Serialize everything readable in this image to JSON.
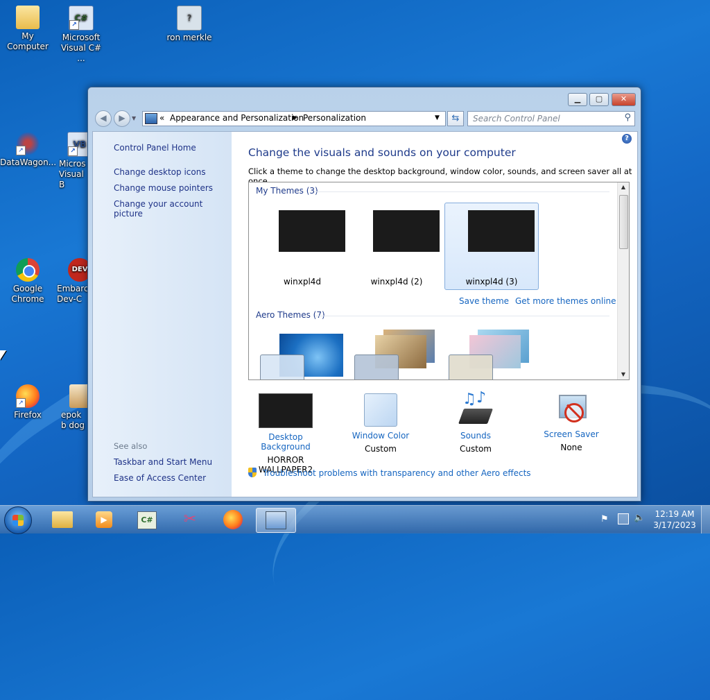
{
  "desktop": {
    "icons": [
      {
        "label": "My Computer"
      },
      {
        "label": "Microsoft Visual C# ..."
      },
      {
        "label": "ron merkle"
      },
      {
        "label": "DataWagon..."
      },
      {
        "label": "Micros Visual B"
      },
      {
        "label": "Google Chrome"
      },
      {
        "label": "Embarca Dev-C"
      },
      {
        "label": "Firefox"
      },
      {
        "label": "epok b dog"
      }
    ]
  },
  "window": {
    "breadcrumb": {
      "root": "Appearance and Personalization",
      "current": "Personalization"
    },
    "search_placeholder": "Search Control Panel",
    "left_pane": {
      "home": "Control Panel Home",
      "links": [
        "Change desktop icons",
        "Change mouse pointers",
        "Change your account picture"
      ],
      "see_also_title": "See also",
      "see_also": [
        "Taskbar and Start Menu",
        "Ease of Access Center"
      ]
    },
    "main": {
      "heading": "Change the visuals and sounds on your computer",
      "subheading": "Click a theme to change the desktop background, window color, sounds, and screen saver all at once.",
      "my_themes_title": "My Themes (3)",
      "my_themes": [
        {
          "name": "winxpl4d",
          "selected": false
        },
        {
          "name": "winxpl4d (2)",
          "selected": false
        },
        {
          "name": "winxpl4d (3)",
          "selected": true
        }
      ],
      "save_theme": "Save theme",
      "get_more": "Get more themes online",
      "aero_themes_title": "Aero Themes (7)",
      "bottom": [
        {
          "label": "Desktop Background",
          "value": "HORROR WALLPAPER2"
        },
        {
          "label": "Window Color",
          "value": "Custom"
        },
        {
          "label": "Sounds",
          "value": "Custom"
        },
        {
          "label": "Screen Saver",
          "value": "None"
        }
      ],
      "troubleshoot": "Troubleshoot problems with transparency and other Aero effects"
    }
  },
  "taskbar": {
    "time": "12:19 AM",
    "date": "3/17/2023"
  },
  "colors": {
    "link": "#1565c0",
    "heading": "#1e3a8a",
    "desktop": "#1468c6"
  }
}
